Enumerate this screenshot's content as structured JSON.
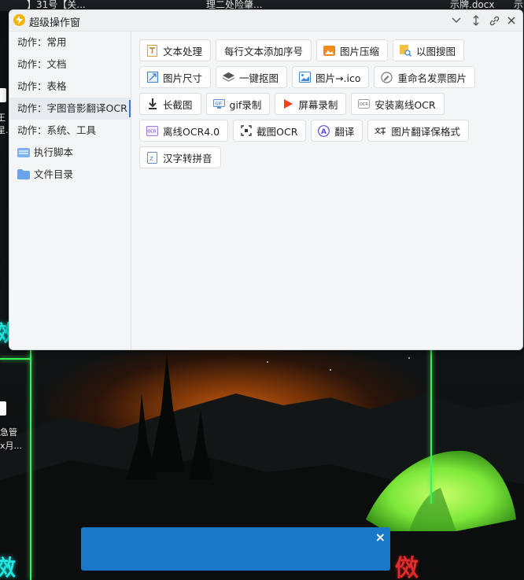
{
  "desktop": {
    "top_bar_texts": [
      "】31号【关...",
      "理二处险肇...",
      "示牌.docx",
      "示"
    ],
    "icon_labels": [
      "急管",
      "x月..."
    ],
    "left_icon_fragments": [
      "王",
      "星."
    ],
    "neon_glyphs": [
      "傚",
      "傚"
    ],
    "red_glyph": "傚"
  },
  "window": {
    "title": "超级操作窗",
    "title_buttons": [
      "minimize-chevron",
      "pin",
      "link",
      "close"
    ]
  },
  "sidebar": {
    "items": [
      {
        "label": "动作：常用",
        "active": false
      },
      {
        "label": "动作：文档",
        "active": false
      },
      {
        "label": "动作：表格",
        "active": false
      },
      {
        "label": "动作：字图音影翻译OCR",
        "active": true
      },
      {
        "label": "动作：系统、工具",
        "active": false
      },
      {
        "label": "执行脚本",
        "icon": "script-folder-icon"
      },
      {
        "label": "文件目录",
        "icon": "folder-icon"
      }
    ]
  },
  "tools": {
    "rows": [
      [
        {
          "label": "文本处理",
          "icon": "text-doc-icon"
        },
        {
          "label": "每行文本添加序号",
          "icon": ""
        },
        {
          "label": "图片压缩",
          "icon": "image-compress-icon"
        },
        {
          "label": "以图搜图",
          "icon": "image-search-icon"
        }
      ],
      [
        {
          "label": "图片尺寸",
          "icon": "image-resize-icon"
        },
        {
          "label": "一键抠图",
          "icon": "layers-icon"
        },
        {
          "label": "图片→.ico",
          "icon": "image-ico-icon"
        },
        {
          "label": "重命名发票图片",
          "icon": "rename-icon"
        }
      ],
      [
        {
          "label": "长截图",
          "icon": "long-screenshot-icon"
        },
        {
          "label": "gif录制",
          "icon": "gif-record-icon"
        },
        {
          "label": "屏幕录制",
          "icon": "screen-record-icon"
        },
        {
          "label": "安装离线OCR",
          "icon": "ocr-install-icon"
        }
      ],
      [
        {
          "label": "离线OCR4.0",
          "icon": "ocr-icon"
        },
        {
          "label": "截图OCR",
          "icon": "screenshot-ocr-icon"
        },
        {
          "label": "翻译",
          "icon": "translate-icon"
        },
        {
          "label": "图片翻译保格式",
          "icon": "image-translate-icon"
        }
      ],
      [
        {
          "label": "汉字转拼音",
          "icon": "pinyin-icon"
        }
      ]
    ]
  },
  "notification": {
    "close_label": "×"
  },
  "colors": {
    "accent": "#2f7be0",
    "notification_bg": "#1a78c8",
    "window_bg": "#f3f5f6",
    "neon_green": "#3cf05a"
  }
}
